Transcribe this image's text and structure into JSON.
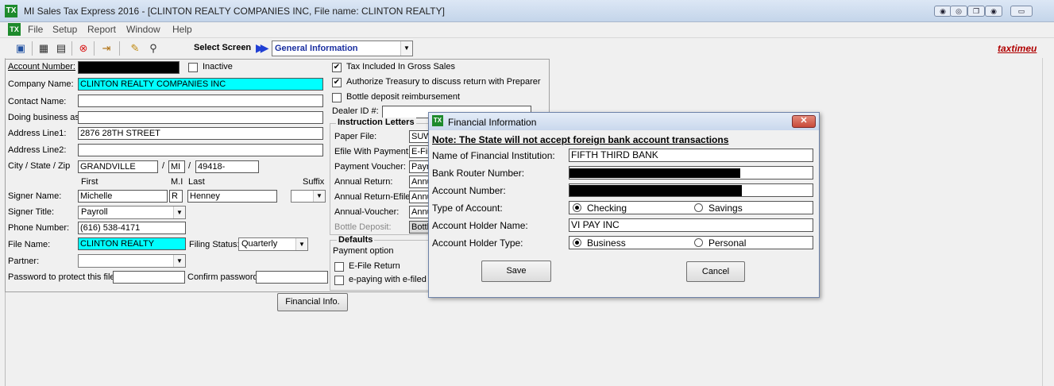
{
  "window": {
    "title": "MI Sales Tax Express 2016 - [CLINTON REALTY COMPANIES INC, File name: CLINTON REALTY]",
    "app_icon_text": "TX"
  },
  "menu": {
    "icon_text": "TX",
    "items": [
      "File",
      "Setup",
      "Report",
      "Window",
      "Help"
    ]
  },
  "toolbar": {
    "select_screen_label": "Select Screen",
    "select_screen_value": "General Information",
    "brand_text": "taxtimeu"
  },
  "form": {
    "account_number_label": "Account Number:",
    "inactive_label": "Inactive",
    "company_name_label": "Company Name:",
    "company_name_value": "CLINTON REALTY COMPANIES INC",
    "contact_name_label": "Contact Name:",
    "contact_name_value": "",
    "dba_label": "Doing business as:",
    "dba_value": "",
    "address1_label": "Address Line1:",
    "address1_value": "2876 28TH STREET",
    "address2_label": "Address Line2:",
    "address2_value": "",
    "csz_label": "City / State / Zip",
    "city_value": "GRANDVILLE",
    "slash": "/",
    "state_value": "MI",
    "zip_value": "49418-",
    "first_col": "First",
    "mi_col": "M.I",
    "last_col": "Last",
    "suffix_col": "Suffix",
    "signer_name_label": "Signer Name:",
    "signer_first": "Michelle",
    "signer_mi": "R",
    "signer_last": "Henney",
    "signer_title_label": "Signer Title:",
    "signer_title_value": "Payroll",
    "phone_label": "Phone Number:",
    "phone_value": "(616) 538-4171",
    "file_name_label": "File Name:",
    "file_name_value": "CLINTON REALTY",
    "filing_status_label": "Filing Status:",
    "filing_status_value": "Quarterly",
    "partner_label": "Partner:",
    "password_label": "Password to protect this file:",
    "confirm_label": "Confirm password:",
    "financial_info_button": "Financial Info."
  },
  "right_panel": {
    "tax_included_label": "Tax Included In Gross Sales",
    "authorize_label": "Authorize Treasury to discuss return with Preparer",
    "bottle_reimb_label": "Bottle deposit reimbursement",
    "dealer_id_label": "Dealer ID #:",
    "instruction_title": "Instruction Letters",
    "instructions": [
      {
        "label": "Paper File:",
        "value": "SUW"
      },
      {
        "label": "Efile With Payment:",
        "value": "E-Fil"
      },
      {
        "label": "Payment Voucher:",
        "value": "Payr"
      },
      {
        "label": "Annual Return:",
        "value": "Annu"
      },
      {
        "label": "Annual Return-Efile:",
        "value": "Annu"
      },
      {
        "label": "Annual-Voucher:",
        "value": "Annu"
      },
      {
        "label": "Bottle Deposit:",
        "value": "Bottl"
      }
    ],
    "defaults_title": "Defaults",
    "payment_option_label": "Payment option",
    "efile_return_label": "E-File Return",
    "epaying_label": "e-paying with e-filed r"
  },
  "dialog": {
    "title": "Financial Information",
    "close_glyph": "✕",
    "note": "Note: The State will not accept foreign bank account transactions",
    "institution_label": "Name of Financial Institution:",
    "institution_value": "FIFTH THIRD BANK",
    "router_label": "Bank Router Number:",
    "account_label": "Account Number:",
    "type_label": "Type of Account:",
    "checking_label": "Checking",
    "savings_label": "Savings",
    "holder_name_label": "Account Holder Name:",
    "holder_name_value": "VI PAY INC",
    "holder_type_label": "Account Holder Type:",
    "business_label": "Business",
    "personal_label": "Personal",
    "save_button": "Save",
    "cancel_button": "Cancel"
  }
}
